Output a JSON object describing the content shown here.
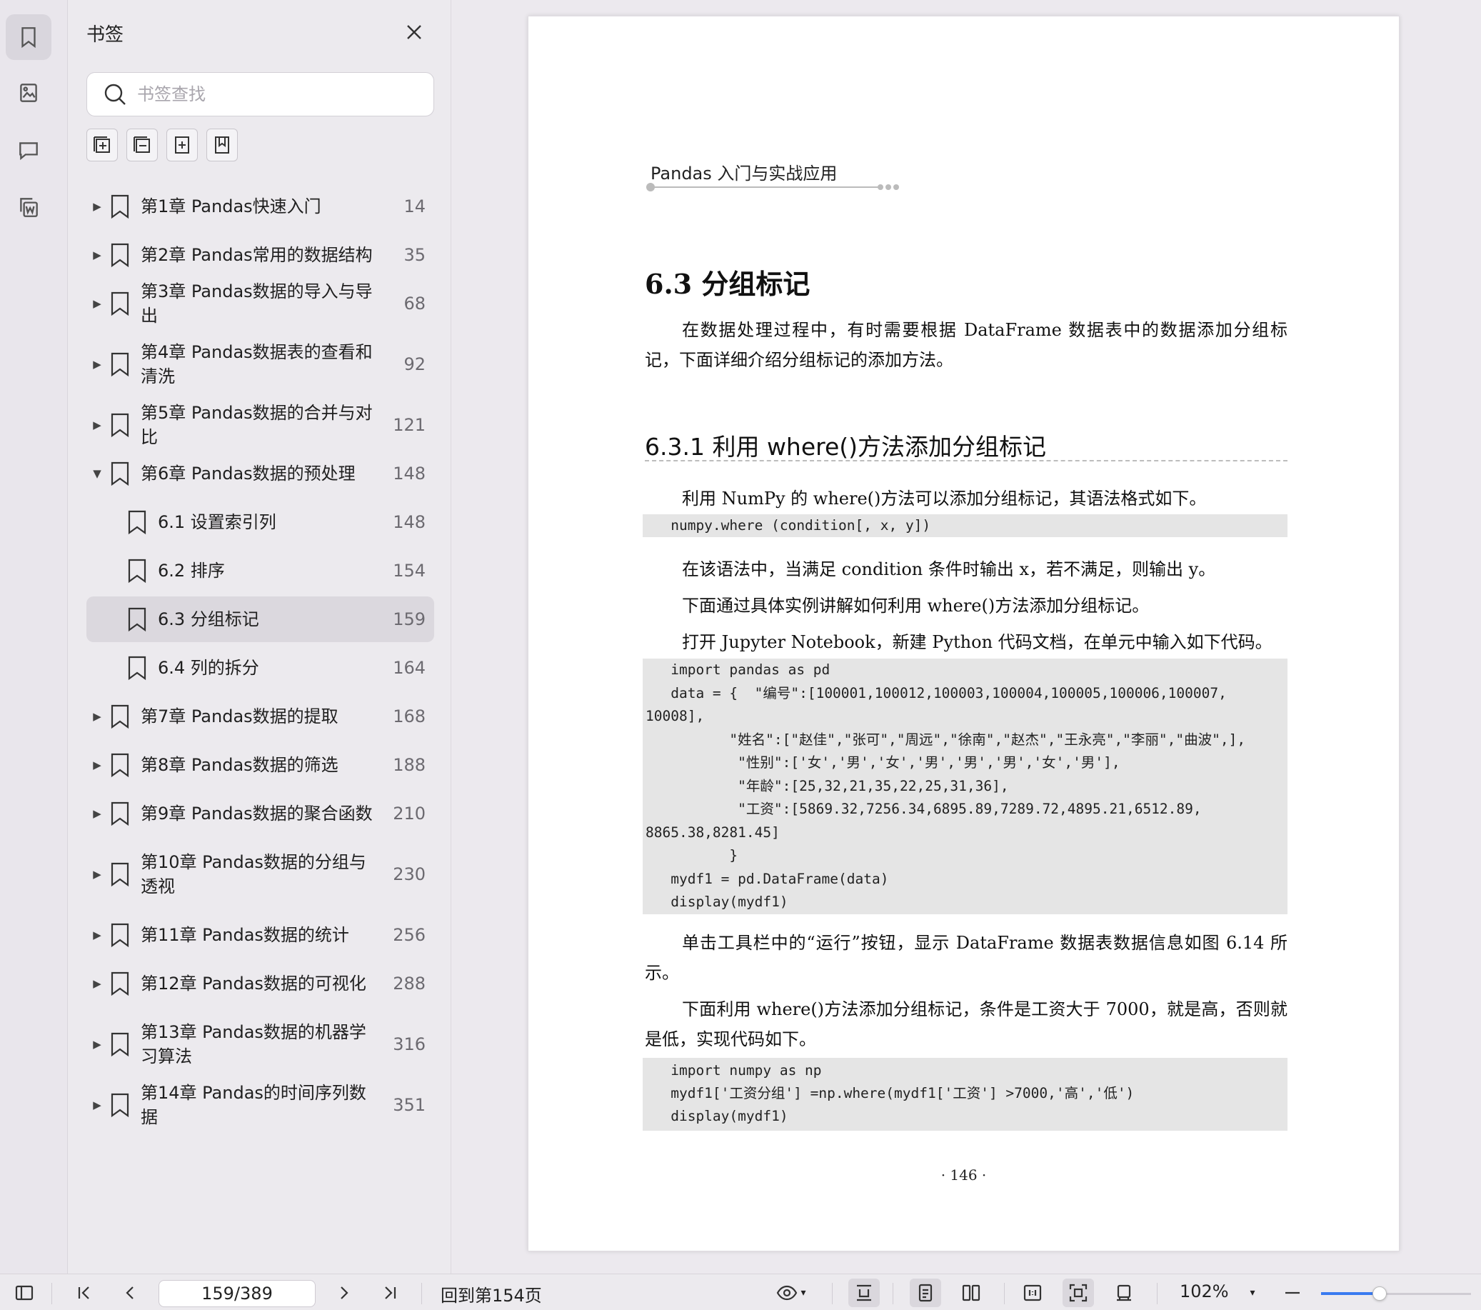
{
  "sidebar_panel": {
    "title": "书签",
    "search_placeholder": "书签查找",
    "bookmarks": [
      {
        "label": "第1章 Pandas快速入门",
        "page": "14",
        "expanded": false
      },
      {
        "label": "第2章 Pandas常用的数据结构",
        "page": "35",
        "expanded": false
      },
      {
        "label": "第3章 Pandas数据的导入与导出",
        "page": "68",
        "expanded": false
      },
      {
        "label": "第4章 Pandas数据表的查看和清洗",
        "page": "92",
        "expanded": false
      },
      {
        "label": "第5章 Pandas数据的合并与对比",
        "page": "121",
        "expanded": false
      },
      {
        "label": "第6章 Pandas数据的预处理",
        "page": "148",
        "expanded": true
      },
      {
        "label": "6.1 设置索引列",
        "page": "148"
      },
      {
        "label": "6.2 排序",
        "page": "154"
      },
      {
        "label": "6.3 分组标记",
        "page": "159",
        "selected": true
      },
      {
        "label": "6.4 列的拆分",
        "page": "164"
      },
      {
        "label": "第7章 Pandas数据的提取",
        "page": "168",
        "expanded": false
      },
      {
        "label": "第8章 Pandas数据的筛选",
        "page": "188",
        "expanded": false
      },
      {
        "label": "第9章 Pandas数据的聚合函数",
        "page": "210",
        "expanded": false
      },
      {
        "label": "第10章 Pandas数据的分组与透视",
        "page": "230",
        "expanded": false
      },
      {
        "label": "第11章 Pandas数据的统计",
        "page": "256",
        "expanded": false
      },
      {
        "label": "第12章 Pandas数据的可视化",
        "page": "288",
        "expanded": false
      },
      {
        "label": "第13章 Pandas数据的机器学习算法",
        "page": "316",
        "expanded": false
      },
      {
        "label": "第14章 Pandas的时间序列数据",
        "page": "351",
        "expanded": false
      }
    ]
  },
  "document": {
    "running_head": "Pandas 入门与实战应用",
    "section_title": "6.3   分组标记",
    "intro": "在数据处理过程中，有时需要根据 DataFrame 数据表中的数据添加分组标记，下面详细介绍分组标记的添加方法。",
    "subsection_title": "6.3.1   利用 where()方法添加分组标记",
    "p1": "利用 NumPy 的 where()方法可以添加分组标记，其语法格式如下。",
    "code1": "   numpy.where (condition[, x, y])",
    "p2": "在该语法中，当满足 condition 条件时输出 x，若不满足，则输出 y。",
    "p3": "下面通过具体实例讲解如何利用 where()方法添加分组标记。",
    "p4": "打开 Jupyter Notebook，新建 Python 代码文档，在单元中输入如下代码。",
    "code2": "   import pandas as pd\n   data = {  \"编号\":[100001,100012,100003,100004,100005,100006,100007,\n10008],\n          \"姓名\":[\"赵佳\",\"张可\",\"周远\",\"徐南\",\"赵杰\",\"王永亮\",\"李丽\",\"曲波\",],\n           \"性别\":['女','男','女','男','男','男','女','男'],\n           \"年龄\":[25,32,21,35,22,25,31,36],\n           \"工资\":[5869.32,7256.34,6895.89,7289.72,4895.21,6512.89,\n8865.38,8281.45]\n          }\n   mydf1 = pd.DataFrame(data)\n   display(mydf1)",
    "p5": "单击工具栏中的“运行”按钮，显示 DataFrame 数据表数据信息如图 6.14 所示。",
    "p6": "下面利用 where()方法添加分组标记，条件是工资大于 7000，就是高，否则就是低，实现代码如下。",
    "code3": "   import numpy as np\n   mydf1['工资分组'] =np.where(mydf1['工资'] >7000,'高','低')\n   display(mydf1)",
    "page_number": "· 146 ·"
  },
  "toolbar": {
    "page_indicator": "159/389",
    "goto_label": "回到第154页",
    "zoom": "102%",
    "zoom_slider_fraction": 0.39
  },
  "colors": {
    "accent": "#3a7bf0",
    "selected_row": "#dbd8de",
    "code_background": "#e5e5e5"
  }
}
